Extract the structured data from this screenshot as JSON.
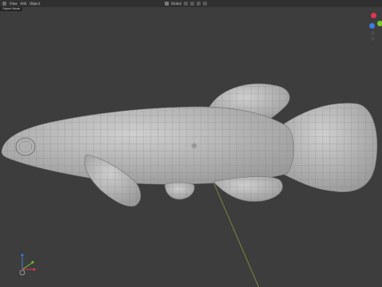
{
  "header": {
    "menu": [
      "View",
      "Add",
      "Object"
    ],
    "tool_label": "Global",
    "sub_label": "Object Mode"
  },
  "colors": {
    "viewport_bg": "#3d3d3d",
    "mesh_fill": "#b8b8b8",
    "wire": "#7a7a7a",
    "gizmo_x": "#e0364e",
    "gizmo_y": "#76c82a",
    "gizmo_z": "#3a7ee0",
    "y_axis_line": "#8a9a3a"
  },
  "icons": {
    "mode": "editor-mode-icon",
    "transform": "transform-pivot-icon",
    "snap": "snap-icon",
    "proportional": "proportional-edit-icon",
    "nav_gizmo": "navigation-gizmo-icon",
    "axis_gizmo": "axis-orientation-icon",
    "origin": "object-origin-icon"
  }
}
